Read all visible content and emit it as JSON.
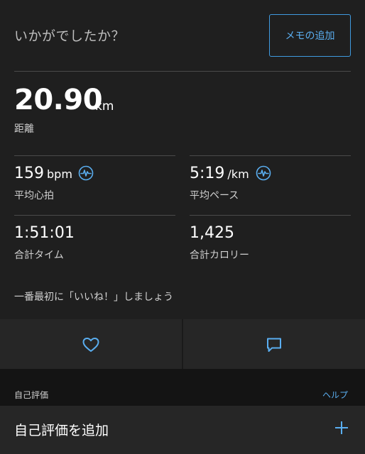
{
  "header": {
    "question": "いかがでしたか？",
    "memo_button": "メモの追加"
  },
  "distance": {
    "value": "20.90",
    "unit": "km",
    "label": "距離"
  },
  "stats": [
    {
      "value": "159",
      "unit": "bpm",
      "label": "平均心拍",
      "icon": "pulse-icon"
    },
    {
      "value": "5:19",
      "unit": "/km",
      "label": "平均ペース",
      "icon": "pulse-icon"
    },
    {
      "value": "1:51:01",
      "unit": "",
      "label": "合計タイム"
    },
    {
      "value": "1,425",
      "unit": "",
      "label": "合計カロリー"
    }
  ],
  "like_note": "一番最初に「いいね！」しましょう",
  "actions": {
    "like_icon": "heart-icon",
    "comment_icon": "comment-icon"
  },
  "self_eval": {
    "title": "自己評価",
    "help": "ヘルプ",
    "add_label": "自己評価を追加",
    "add_icon": "plus-icon"
  },
  "colors": {
    "background": "#1f1f1f",
    "accent": "#3f9be0",
    "divider": "#4a4a4a"
  }
}
